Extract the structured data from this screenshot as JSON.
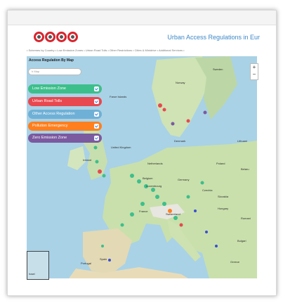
{
  "header": {
    "site_title": "Urban Access Regulations in Eur"
  },
  "nav": {
    "items_text": "• Schemes by Country • Low Emission Zones • Urban Road Tolls • Other Restrictions • Cities & Minidrive • Additional Services •"
  },
  "panel": {
    "title": "Access Regulation By Map",
    "search_placeholder": "h Map",
    "categories": [
      {
        "label": "Low Emission Zone",
        "color": "#3dbf8b"
      },
      {
        "label": "Urban Road Tolls",
        "color": "#e8484f"
      },
      {
        "label": "Other Access Regulation",
        "color": "#6fb0d6"
      },
      {
        "label": "Pollution Emergency",
        "color": "#ff7f1f"
      },
      {
        "label": "Zero Emission Zone",
        "color": "#7b5aa0"
      }
    ]
  },
  "map": {
    "zoom_in": "+",
    "zoom_out": "−",
    "labels": {
      "faroe": "Faroe Islands",
      "norway": "Norway",
      "sweden": "Sweden",
      "denmark": "Denmark",
      "lithuania": "Lithuani",
      "united_kingdom": "United Kingdom",
      "ireland": "Ireland",
      "netherlands": "Netherlands",
      "poland": "Poland",
      "germany": "Germany",
      "belarus": "Belaru",
      "belgium": "Belgium",
      "czechia": "Czechia",
      "luxembourg": "Luxembourg",
      "slovakia": "Slovakia",
      "hungary": "Hungary",
      "france": "France",
      "switzerland": "Switzerland",
      "romania": "Romani",
      "portugal": "Portugal",
      "spain": "Spain",
      "greece": "Greece",
      "bulgaria": "Bulgari",
      "israel": "Israel"
    }
  }
}
